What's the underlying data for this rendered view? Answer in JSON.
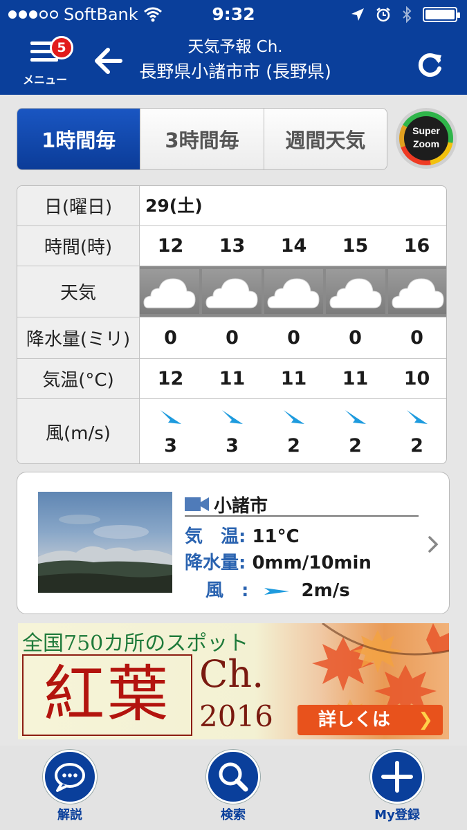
{
  "status_bar": {
    "carrier": "SoftBank",
    "time": "9:32",
    "battery_level": 1.0
  },
  "header": {
    "menu_label": "メニュー",
    "menu_badge": "5",
    "title": "天気予報 Ch.",
    "location": "長野県小諸市市 (長野県)"
  },
  "tabs": [
    {
      "label": "1時間毎",
      "active": true
    },
    {
      "label": "3時間毎",
      "active": false
    },
    {
      "label": "週間天気",
      "active": false
    }
  ],
  "superzoom": {
    "line1": "Super",
    "line2": "Zoom"
  },
  "forecast": {
    "row_labels": {
      "day": "日(曜日)",
      "time": "時間(時)",
      "weather": "天気",
      "rain": "降水量(ミリ)",
      "temp": "気温(°C)",
      "wind": "風(m/s)"
    },
    "day": "29(土)",
    "hours": [
      "12",
      "13",
      "14",
      "15",
      "16"
    ],
    "weather": [
      "cloud-icon",
      "cloud-icon",
      "cloud-icon",
      "cloud-icon",
      "cloud-icon"
    ],
    "rain": [
      "0",
      "0",
      "0",
      "0",
      "0"
    ],
    "temp": [
      "12",
      "11",
      "11",
      "11",
      "10"
    ],
    "wind_speed": [
      "3",
      "3",
      "2",
      "2",
      "2"
    ],
    "wind_direction_icon": "wind-arrow-icon"
  },
  "livecam": {
    "place": "小諸市",
    "temp_label": "気　温:",
    "temp_value": "11°C",
    "rain_label": "降水量:",
    "rain_value": "0mm/10min",
    "wind_label": "風　:",
    "wind_value": "2m/s"
  },
  "banner": {
    "headline": "全国750カ所のスポット",
    "title": "紅葉",
    "ch": "Ch.",
    "year": "2016",
    "cta": "詳しくは"
  },
  "bottom_nav": [
    {
      "label": "解説",
      "icon": "chat-bubble-icon"
    },
    {
      "label": "検索",
      "icon": "search-icon"
    },
    {
      "label": "My登録",
      "icon": "plus-icon"
    }
  ],
  "colors": {
    "brand_blue": "#0a3f9b",
    "badge_red": "#e21b1b",
    "label_blue": "#2a63b0",
    "cta_orange": "#e8521c"
  }
}
